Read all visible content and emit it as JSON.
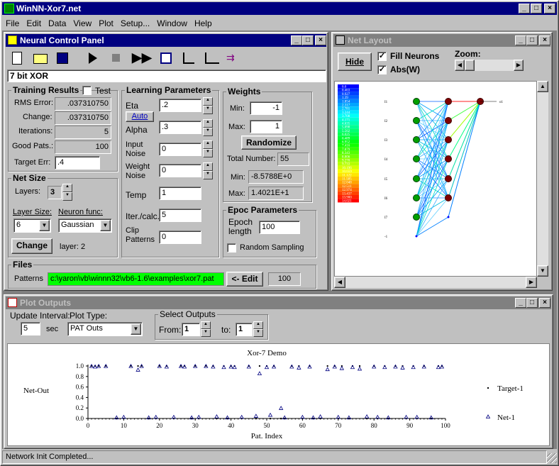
{
  "app": {
    "title": "WinNN-Xor7.net",
    "menu": [
      "File",
      "Edit",
      "Data",
      "View",
      "Plot",
      "Setup...",
      "Window",
      "Help"
    ],
    "min": "_",
    "max": "□",
    "close": "×"
  },
  "ncp": {
    "title": "Neural Control Panel",
    "problem": "7 bit XOR",
    "training": {
      "title": "Training Results",
      "test": "Test",
      "rms_label": "RMS Error:",
      "rms": ".037310750",
      "change_label": "Change:",
      "change": ".037310750",
      "iter_label": "Iterations:",
      "iter": "5",
      "good_label": "Good Pats.:",
      "good": "100",
      "target_label": "Target Err:",
      "target": ".4"
    },
    "netsize": {
      "title": "Net Size",
      "layers_label": "Layers:",
      "layers": "3",
      "layersize_label": "Layer Size:",
      "layersize": "6",
      "neuronfunc_label": "Neuron func:",
      "neuronfunc": "Gaussian",
      "change": "Change",
      "layer": "layer:  2"
    },
    "learning": {
      "title": "Learning Parameters",
      "eta": "Eta",
      "eta_val": ".2",
      "auto": "Auto",
      "alpha": "Alpha",
      "alpha_val": ".3",
      "input_noise": "Input",
      "input_noise2": "Noise",
      "input_noise_val": "0",
      "weight_noise": "Weight",
      "weight_noise2": "Noise",
      "weight_noise_val": "0",
      "temp": "Temp",
      "temp_val": "1",
      "iter": "Iter./calc.",
      "iter_val": "5",
      "clip": "Clip",
      "clip2": "Patterns",
      "clip_val": "0"
    },
    "weights": {
      "title": "Weights",
      "min_label": "Min:",
      "min": "-1",
      "max_label": "Max:",
      "max": "1",
      "randomize": "Randomize",
      "total_label": "Total Number:",
      "total": "55",
      "wmin_label": "Min:",
      "wmin": "-8.5788E+0",
      "wmax_label": "Max:",
      "wmax": "1.4021E+1"
    },
    "epoc": {
      "title": "Epoc Parameters",
      "len_label": "Epoch",
      "len_label2": "length",
      "len": "100",
      "random": "Random Sampling"
    },
    "files": {
      "title": "Files",
      "patterns_label": "Patterns",
      "path": "c:\\yaron\\vb\\winnn32\\vb6-1.6\\examples\\xor7.pat",
      "edit": "<- Edit",
      "count": "100"
    }
  },
  "netlayout": {
    "title": "Net Layout",
    "hide": "Hide",
    "fill": "Fill Neurons",
    "abs": "Abs(W)",
    "zoom": "Zoom:",
    "colorscale": [
      "0.0",
      "0.463",
      "0.927",
      "1.39",
      "1.854",
      "2.317",
      "2.781",
      "3.244",
      "3.708",
      "4.171",
      "4.635",
      "5.098",
      "5.562",
      "6.025",
      "6.489",
      "6.952",
      "7.416",
      "7.879",
      "8.343",
      "8.806",
      "9.270",
      "9.733",
      "10.196",
      "10.659",
      "11.122",
      "11.585",
      "12.048",
      "12.511",
      "12.974",
      "13.437",
      "13.900",
      "14.021"
    ],
    "inputs": [
      "I1",
      "I2",
      "I3",
      "I4",
      "I5",
      "I6",
      "I7",
      "-1"
    ],
    "output": "o1"
  },
  "plot": {
    "title": "Plot Outputs",
    "update_label": "Update Interval:",
    "update": "5",
    "sec": "sec",
    "type_label": "Plot Type:",
    "type": "PAT Outs",
    "select_label": "Select Outputs",
    "from_label": "From:",
    "from": "1",
    "to_label": "to:",
    "to": "1"
  },
  "chart_data": {
    "type": "scatter",
    "title": "Xor-7 Demo",
    "xlabel": "Pat. Index",
    "ylabel": "Net-Out",
    "xlim": [
      0,
      100
    ],
    "ylim": [
      0,
      1
    ],
    "xticks": [
      0,
      10,
      20,
      30,
      40,
      50,
      60,
      70,
      80,
      90,
      100
    ],
    "yticks": [
      "0.0",
      "0.2",
      "0.4",
      "0.6",
      "0.8",
      "1.0"
    ],
    "series": [
      {
        "name": "Target-1",
        "x": [
          1,
          2,
          3,
          5,
          8,
          10,
          12,
          14,
          15,
          17,
          19,
          20,
          22,
          24,
          26,
          27,
          29,
          30,
          31,
          33,
          35,
          36,
          38,
          39,
          40,
          41,
          43,
          45,
          47,
          48,
          50,
          51,
          52,
          54,
          55,
          57,
          59,
          60,
          62,
          63,
          65,
          67,
          69,
          70,
          71,
          73,
          74,
          76,
          78,
          80,
          81,
          83,
          84,
          86,
          88,
          89,
          91,
          92,
          94,
          96,
          98,
          99
        ],
        "y": [
          1,
          1,
          1,
          1,
          0,
          0,
          1,
          1,
          1,
          0,
          0,
          1,
          1,
          0,
          1,
          1,
          0,
          1,
          0,
          1,
          1,
          0,
          1,
          0,
          1,
          1,
          0,
          1,
          0,
          1,
          1,
          0,
          1,
          0,
          0,
          1,
          1,
          0,
          1,
          0,
          0,
          1,
          1,
          0,
          1,
          0,
          1,
          1,
          0,
          1,
          0,
          1,
          0,
          1,
          1,
          0,
          1,
          0,
          1,
          0,
          1,
          1
        ]
      },
      {
        "name": "Net-1",
        "x": [
          1,
          2,
          3,
          5,
          8,
          10,
          12,
          14,
          15,
          17,
          19,
          20,
          22,
          24,
          26,
          27,
          29,
          30,
          31,
          33,
          35,
          36,
          38,
          39,
          40,
          41,
          43,
          45,
          47,
          48,
          50,
          51,
          52,
          54,
          55,
          57,
          59,
          60,
          62,
          63,
          65,
          67,
          69,
          70,
          71,
          73,
          74,
          76,
          78,
          80,
          81,
          83,
          84,
          86,
          88,
          89,
          91,
          92,
          94,
          96,
          98,
          99
        ],
        "y": [
          0.99,
          0.98,
          0.99,
          0.99,
          0.01,
          0.02,
          0.99,
          0.92,
          0.99,
          0.01,
          0.02,
          0.99,
          0.98,
          0.02,
          0.99,
          0.98,
          0.01,
          0.99,
          0.02,
          0.99,
          0.98,
          0.03,
          0.97,
          0.01,
          0.98,
          0.97,
          0.02,
          0.98,
          0.04,
          0.85,
          0.97,
          0.06,
          0.98,
          0.19,
          0.01,
          0.98,
          0.96,
          0.02,
          0.98,
          0.01,
          0.03,
          0.93,
          0.98,
          0.02,
          0.95,
          0.01,
          0.97,
          0.94,
          0.03,
          0.98,
          0.02,
          0.97,
          0.01,
          0.98,
          0.96,
          0.02,
          0.97,
          0.02,
          0.98,
          0.01,
          0.97,
          0.98
        ]
      }
    ],
    "legend": [
      "Target-1",
      "Net-1"
    ]
  },
  "status": "Network Init Completed..."
}
